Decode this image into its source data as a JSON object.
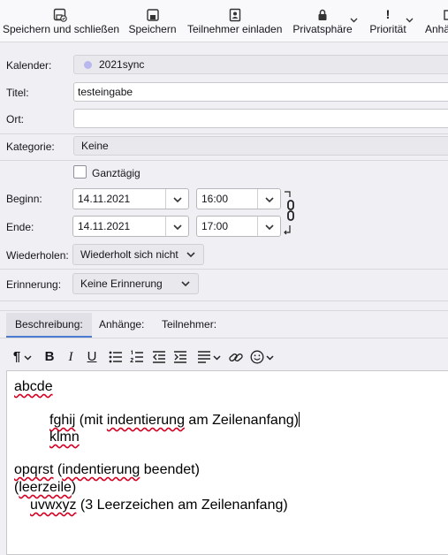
{
  "toolbar": {
    "save_close": "Speichern und schließen",
    "save": "Speichern",
    "invite": "Teilnehmer einladen",
    "privacy": "Privatsphäre",
    "priority": "Priorität",
    "more": "Anhä"
  },
  "form": {
    "calendar_label": "Kalender:",
    "calendar_value": "2021sync",
    "calendar_color": "#b8b8ee",
    "title_label": "Titel:",
    "title_value": "testeingabe",
    "location_label": "Ort:",
    "location_value": "",
    "category_label": "Kategorie:",
    "category_value": "Keine",
    "allday_label": "Ganztägig",
    "start_label": "Beginn:",
    "start_date": "14.11.2021",
    "start_time": "16:00",
    "end_label": "Ende:",
    "end_date": "14.11.2021",
    "end_time": "17:00",
    "repeat_label": "Wiederholen:",
    "repeat_value": "Wiederholt sich nicht",
    "reminder_label": "Erinnerung:",
    "reminder_value": "Keine Erinnerung"
  },
  "tabs": {
    "description": "Beschreibung:",
    "attachments": "Anhänge:",
    "attendees": "Teilnehmer:"
  },
  "editor_toolbar": {
    "paragraph_icon": "¶",
    "bold": "B",
    "italic": "I",
    "underline": "U"
  },
  "editor": {
    "line1": "abcde",
    "line2_word": "fghij",
    "line2_a": " (mit ",
    "line2_word2": "indentierung",
    "line2_b": " am Zeilenanfang)",
    "line3": "klmn",
    "line4_word": "opqrst",
    "line4_a": " (",
    "line4_word2": "indentierung",
    "line4_b": " beendet)",
    "line5_a": "(",
    "line5_word": "leerzeile",
    "line5_b": ")",
    "line6_word": "uvwxyz",
    "line6_b": " (3 Leerzeichen am Zeilenanfang)"
  },
  "colors": {
    "accent": "#4a7bd0",
    "spellcheck": "#d70022"
  }
}
